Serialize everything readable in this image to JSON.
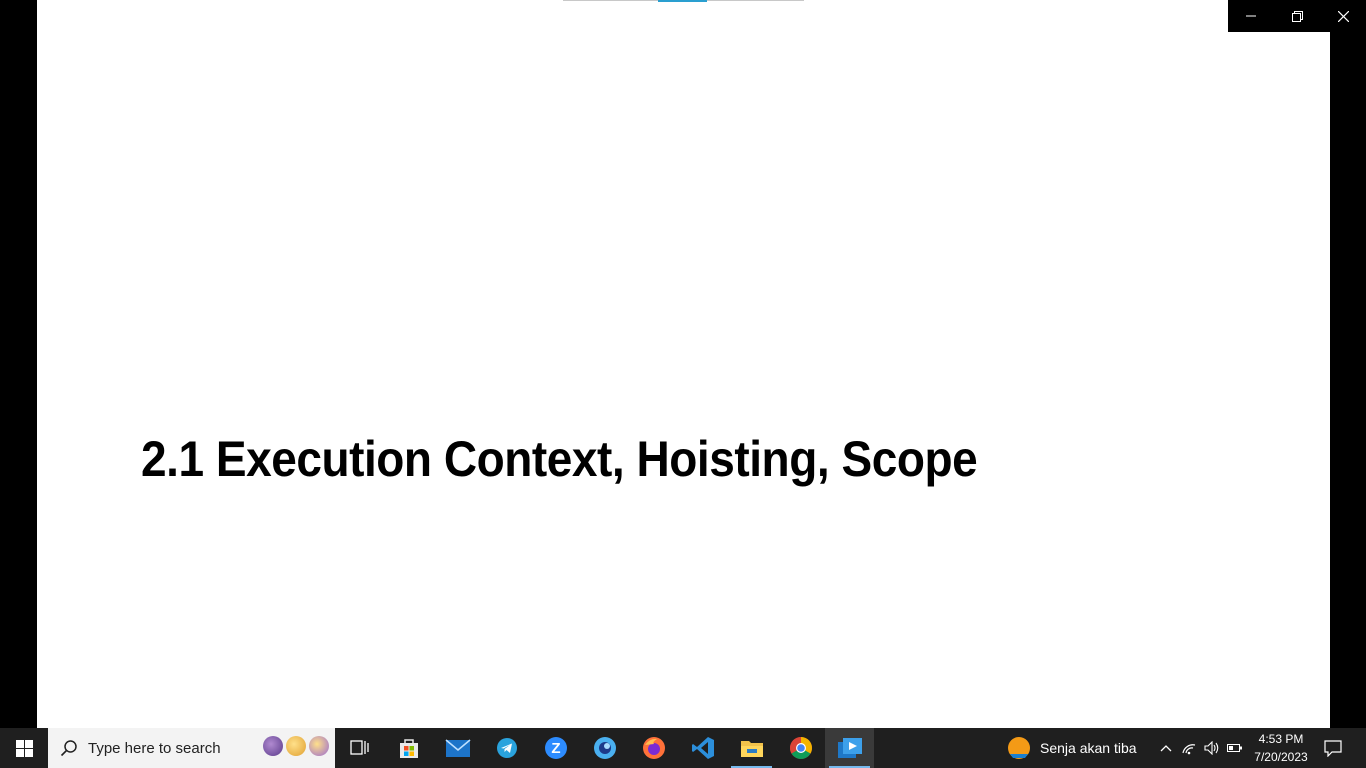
{
  "slide": {
    "title": "2.1 Execution Context, Hoisting, Scope"
  },
  "window_controls": {
    "minimize_icon": "minimize-icon",
    "restore_icon": "restore-icon",
    "close_icon": "close-icon"
  },
  "taskbar": {
    "search": {
      "placeholder": "Type here to search",
      "value": ""
    },
    "apps": [
      "task-view-icon",
      "microsoft-store-icon",
      "mail-icon",
      "telegram-icon",
      "zoom-icon",
      "app-circle-icon",
      "firefox-icon",
      "vscode-icon",
      "file-explorer-icon",
      "chrome-icon",
      "media-player-icon"
    ],
    "weather": {
      "text": "Senja akan tiba"
    },
    "clock": {
      "time": "4:53 PM",
      "date": "7/20/2023"
    }
  },
  "colors": {
    "taskbar": "#1f1f1f",
    "accent": "#76b9ed",
    "progress": "#2a9fd0"
  }
}
